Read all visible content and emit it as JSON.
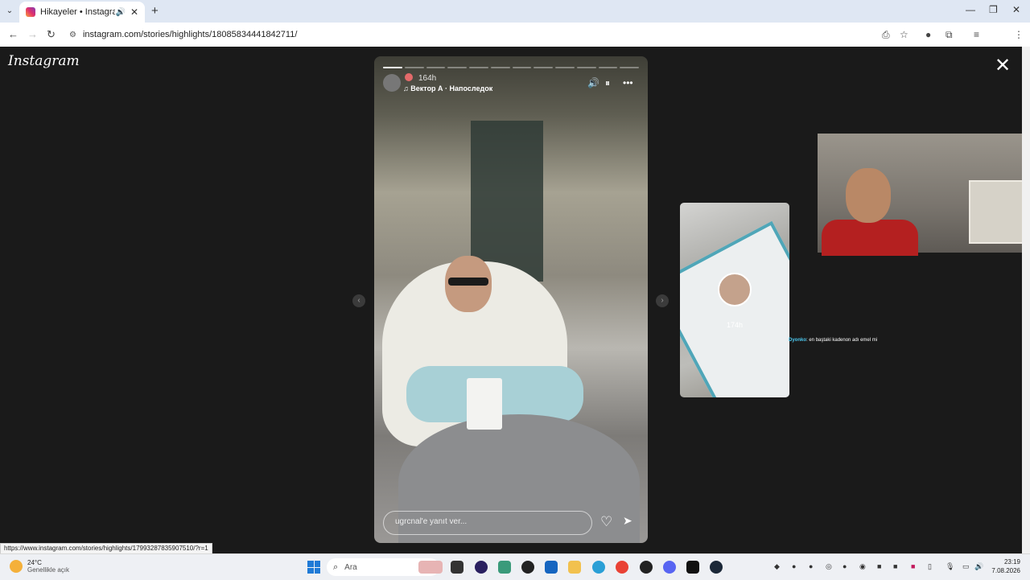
{
  "browser": {
    "tab": {
      "title": "Hikayeler • Instagram",
      "audio_icon": "speaker-icon",
      "close_label": "✕"
    },
    "tablist_label": "⌄",
    "new_tab_label": "+",
    "window_controls": {
      "minimize": "—",
      "maximize": "❐",
      "close": "✕"
    },
    "nav": {
      "back": "←",
      "forward": "→",
      "reload": "↻"
    },
    "url": "instagram.com/stories/highlights/18085834441842711/",
    "toolbar_icons": [
      "install-icon",
      "star-icon",
      "extension-color-icon",
      "extensions-icon",
      "media-icon",
      "profile-avatar",
      "menu-icon"
    ]
  },
  "instagram": {
    "logo": "Instagram",
    "close_label": "✕",
    "story": {
      "segments_total": 12,
      "segments_done": 1,
      "time": "164h",
      "music": "Вектор А · Напоследок",
      "controls": {
        "mute": "🔊",
        "pause": "⏸",
        "more": "•••"
      },
      "reply_placeholder": "ugrcnal'e yanıt ver...",
      "heart": "♡",
      "send": "➤"
    },
    "prev_arrow": "‹",
    "next_arrow": "›",
    "next_story": {
      "time": "174h"
    }
  },
  "overlay": {
    "chat_user": "Dyonko",
    "chat_message": ": en baştaki kadenon adı emel mi"
  },
  "status_url": "https://www.instagram.com/stories/highlights/17993287835907510/?r=1",
  "taskbar": {
    "weather_temp": "24°C",
    "weather_desc": "Genellikle açık",
    "search_placeholder": "Ara",
    "clock_time": "23:19",
    "clock_date": "7.08.2026"
  }
}
